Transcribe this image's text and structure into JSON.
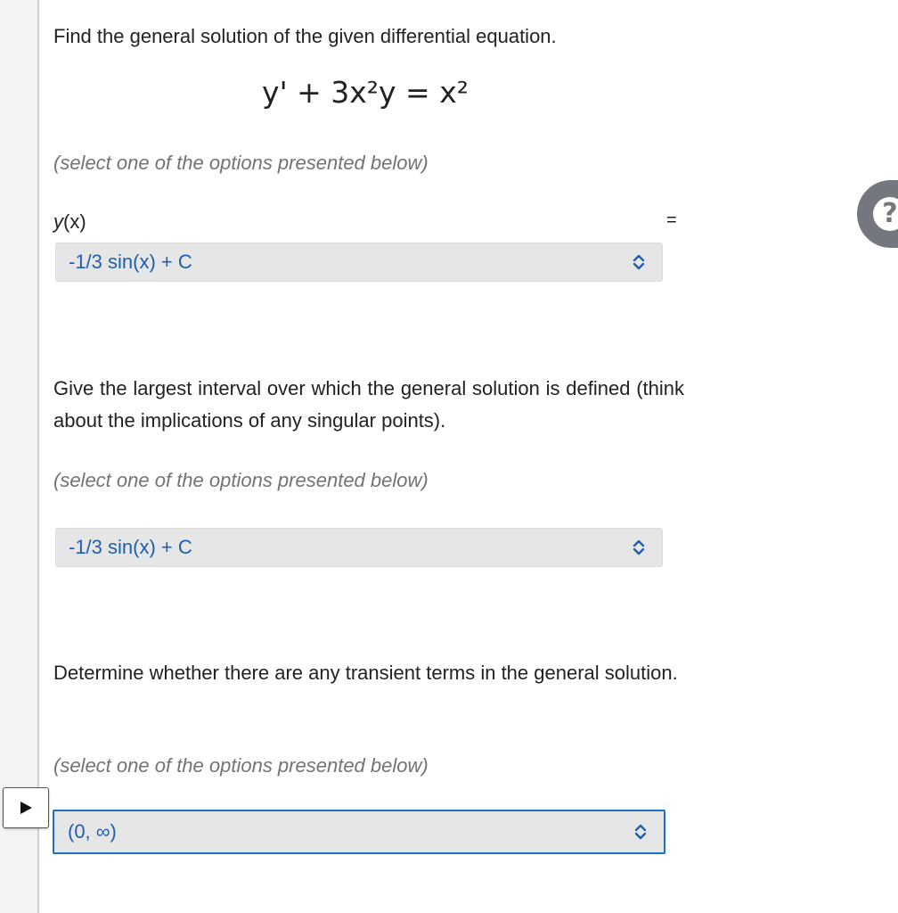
{
  "question1": {
    "prompt": "Find the general solution of the given differential equation.",
    "equation": "y' + 3x²y = x²",
    "hint": "(select one of the options presented below)",
    "answer_label_fn": "y",
    "answer_label_arg": "(x)",
    "equals": "=",
    "select_value": "-1/3 sin(x) + C"
  },
  "question2": {
    "prompt": "Give the largest interval over which the general solution is defined (think about the implications of any singular points).",
    "hint": "(select one of the options presented below)",
    "select_value": "-1/3 sin(x) + C"
  },
  "question3": {
    "prompt": "Determine whether there are any transient terms in the general solution.",
    "hint": "(select one of the options presented below)",
    "select_value": "(0, ∞)"
  },
  "help": {
    "symbol": "?"
  },
  "icons": {
    "play": "play-icon",
    "select_arrows": "select-arrows-icon",
    "help": "help-icon"
  },
  "colors": {
    "select_text": "#1f5fb0",
    "focus_border": "#1f6fc5",
    "hint_text": "#737373",
    "select_bg": "#e6e6e6"
  }
}
